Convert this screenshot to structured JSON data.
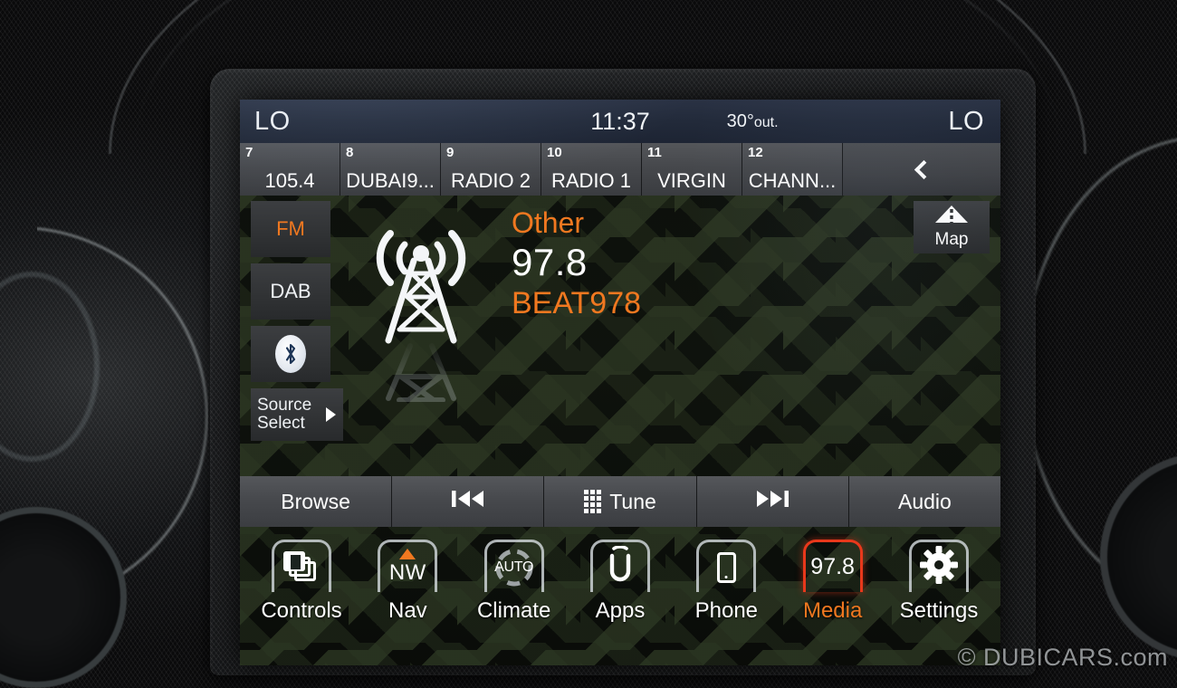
{
  "status_bar": {
    "left_temp": "LO",
    "clock": "11:37",
    "outside_temp": "30°",
    "outside_unit": "out.",
    "right_temp": "LO"
  },
  "presets": [
    {
      "number": "7",
      "label": "105.4"
    },
    {
      "number": "8",
      "label": "DUBAI9..."
    },
    {
      "number": "9",
      "label": "RADIO 2"
    },
    {
      "number": "10",
      "label": "RADIO 1"
    },
    {
      "number": "11",
      "label": "VIRGIN"
    },
    {
      "number": "12",
      "label": "CHANN..."
    }
  ],
  "preset_back_icon": "chevron-left-icon",
  "source_buttons": [
    {
      "label": "FM",
      "icon": "",
      "active": true
    },
    {
      "label": "DAB",
      "icon": "",
      "active": false
    },
    {
      "label": "",
      "icon": "bluetooth-icon",
      "active": false
    }
  ],
  "source_select": {
    "line1": "Source",
    "line2": "Select",
    "arrow_icon": "triangle-right-icon"
  },
  "station": {
    "type": "Other",
    "frequency": "97.8",
    "name": "BEAT978",
    "icon": "radio-tower-icon"
  },
  "map_button": {
    "label": "Map",
    "icon": "map-road-icon"
  },
  "control_bar": [
    {
      "label": "Browse",
      "icon": ""
    },
    {
      "label": "",
      "icon": "previous-track-icon"
    },
    {
      "label": "Tune",
      "icon": "keypad-icon"
    },
    {
      "label": "",
      "icon": "next-track-icon"
    },
    {
      "label": "Audio",
      "icon": ""
    }
  ],
  "nav_bar": [
    {
      "label": "Controls",
      "icon": "stacked-cards-icon",
      "value": "",
      "active": false
    },
    {
      "label": "Nav",
      "icon": "compass-icon",
      "value": "NW",
      "active": false
    },
    {
      "label": "Climate",
      "icon": "climate-auto-icon",
      "value": "AUTO",
      "active": false
    },
    {
      "label": "Apps",
      "icon": "uconnect-icon",
      "value": "",
      "active": false
    },
    {
      "label": "Phone",
      "icon": "smartphone-icon",
      "value": "",
      "active": false
    },
    {
      "label": "Media",
      "icon": "",
      "value": "97.8",
      "active": true
    },
    {
      "label": "Settings",
      "icon": "gear-icon",
      "value": "",
      "active": false
    }
  ],
  "watermark": "© DUBICARS.com",
  "colors": {
    "accent_orange": "#f07820",
    "active_red": "#e8381b",
    "text_white": "#ffffff",
    "status_bar_blue": "#2a3244",
    "button_gray": "#3a3c40"
  }
}
